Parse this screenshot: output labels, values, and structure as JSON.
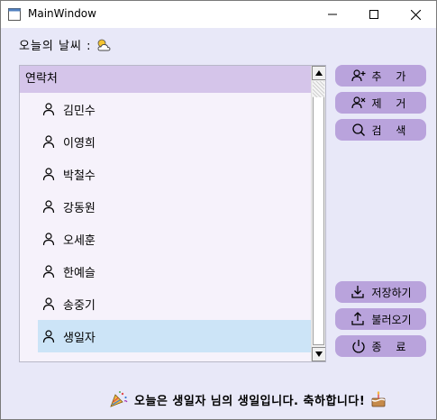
{
  "window": {
    "title": "MainWindow"
  },
  "weather": {
    "label": "오늘의 날씨 :",
    "icon": "partly-cloudy-icon"
  },
  "contacts": {
    "header": "연락처",
    "items": [
      {
        "name": "김민수",
        "icon": "person-icon",
        "selected": false
      },
      {
        "name": "이영희",
        "icon": "person-icon",
        "selected": false
      },
      {
        "name": "박철수",
        "icon": "person-icon",
        "selected": false
      },
      {
        "name": "강동원",
        "icon": "person-icon",
        "selected": false
      },
      {
        "name": "오세훈",
        "icon": "person-icon",
        "selected": false
      },
      {
        "name": "한예슬",
        "icon": "person-icon",
        "selected": false
      },
      {
        "name": "송중기",
        "icon": "person-icon",
        "selected": false
      },
      {
        "name": "생일자",
        "icon": "person-icon",
        "selected": true
      }
    ]
  },
  "buttons": {
    "add": "추 가",
    "remove": "제 거",
    "search": "검 색",
    "save": "저장하기",
    "load": "불러오기",
    "exit": "종 료"
  },
  "footer": {
    "message": "오늘은 생일자 님의 생일입니다. 축하합니다!"
  },
  "colors": {
    "accent": "#b9a3dc",
    "header": "#d5c5ea",
    "selected": "#cce4f7",
    "background": "#e8e8f8"
  }
}
